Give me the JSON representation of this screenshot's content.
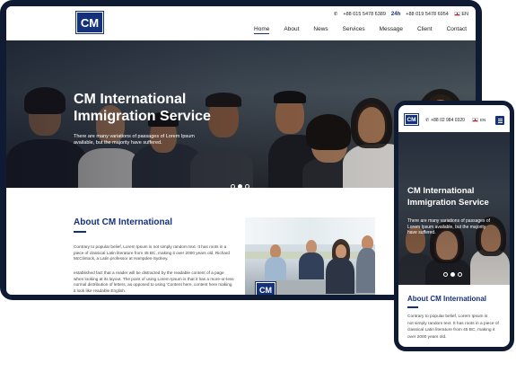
{
  "desktop": {
    "logo_text": "CM",
    "top_bar": {
      "phone_icon": "phone-icon",
      "phone": "+88 015 5478 6389",
      "label_24h": "24h",
      "phone_24h": "+88 019 5478 6954",
      "lang": "EN"
    },
    "nav": [
      "Home",
      "About",
      "News",
      "Services",
      "Message",
      "Client",
      "Contact"
    ],
    "active_nav": "Home",
    "hero": {
      "title_line1": "CM International",
      "title_line2": "Immigration Service",
      "description_line1": "There are many variations of passages of Lorem Ipsum",
      "description_line2": "available, but the majority have suffered."
    },
    "about": {
      "heading": "About CM International",
      "para1_line1": "Contrary to popular belief, Lorem Ipsum is not simply random text. It has roots in a",
      "para1_line2": "piece of classical Latin literature from 45 BC, making it over 2000 years old. Richard",
      "para1_line3": "McClintock, a Latin professor at Hampden-Sydney.",
      "para2_line1": "established fact that a reader will be distracted by the readable content of a page",
      "para2_line2": "when looking at its layout. The point of using Lorem Ipsum is that it has a more-or-less",
      "para2_line3": "normal distribution of letters, as opposed to using 'Content here, content here making",
      "para2_line4": "it look like readable English."
    },
    "slider_active_index": 1
  },
  "mobile": {
    "logo_text": "CM",
    "phone": "+88 02 984 0320",
    "lang": "EN",
    "hero": {
      "title_line1": "CM International",
      "title_line2": "Immigration Service",
      "description_line1": "There are many variations of passages of",
      "description_line2": "Lorem Ipsum available, but the majority",
      "description_line3": "have suffered."
    },
    "about": {
      "heading": "About CM International",
      "line1": "Contrary to popular belief, Lorem Ipsum is",
      "line2": "not simply random text. It has roots in a piece of",
      "line3": "classical Latin literature from 45 BC, making it",
      "line4": "over 2000 years old."
    },
    "slider_active_index": 1
  },
  "colors": {
    "brand": "#14317a",
    "frame": "#0f1a33"
  }
}
